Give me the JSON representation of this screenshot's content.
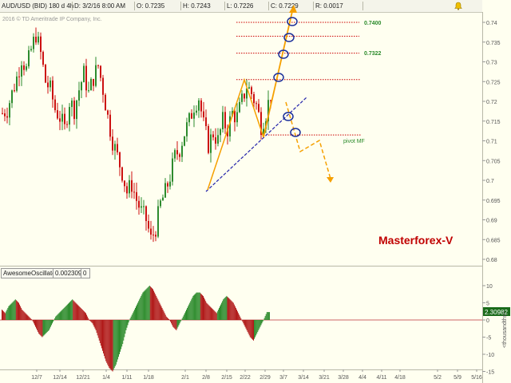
{
  "header": {
    "symbol": "AUD/USD (BID) 180 d 4h",
    "date": "D: 3/2/16 8:00 AM",
    "open": "O: 0.7235",
    "high": "H: 0.7243",
    "low": "L: 0.7226",
    "close": "C: 0.7229",
    "range": "R: 0.0017"
  },
  "copyright": "2016 © TD Ameritrade IP Company, Inc.",
  "oscillator": {
    "name": "AwesomeOscillator",
    "value": "0.0023098",
    "extra": "0",
    "last_value_tag": "2.30982",
    "units_label": "<thousandths>"
  },
  "annotations": {
    "brand": "Masterforex-V",
    "pivot": "pivot MF",
    "target_high": "0.7400",
    "target_mid": "0.7322"
  },
  "colors": {
    "up": "#2e8b2e",
    "down": "#cc1111",
    "osc_green": "#2b8a2b",
    "osc_red": "#b01818",
    "level_lines": "#cc0000",
    "orange": "#f5a000",
    "trend": "#2222aa",
    "circle": "#1a2f9a",
    "brand": "#c00000",
    "label_green": "#2a8a2a"
  },
  "chart_data": [
    {
      "type": "candlestick",
      "title": "AUD/USD (BID) 180 d 4h",
      "ylim": [
        0.678,
        0.745
      ],
      "y_ticks": [
        0.68,
        0.685,
        0.69,
        0.695,
        0.7,
        0.705,
        0.71,
        0.715,
        0.72,
        0.725,
        0.73,
        0.735,
        0.74
      ],
      "x_tick_labels": [
        "12/7",
        "12/14",
        "12/21",
        "1/4",
        "1/11",
        "1/18",
        "2/1",
        "2/8",
        "2/15",
        "2/22",
        "2/29",
        "3/7",
        "3/14",
        "3/21",
        "3/28",
        "4/4",
        "4/11",
        "4/18",
        "5/2",
        "5/9",
        "5/16"
      ],
      "close_path": [
        [
          0,
          0.717
        ],
        [
          6,
          0.718
        ],
        [
          12,
          0.722
        ],
        [
          18,
          0.726
        ],
        [
          24,
          0.731
        ],
        [
          30,
          0.728
        ],
        [
          36,
          0.733
        ],
        [
          42,
          0.737
        ],
        [
          48,
          0.732
        ],
        [
          54,
          0.725
        ],
        [
          60,
          0.723
        ],
        [
          66,
          0.718
        ],
        [
          72,
          0.716
        ],
        [
          78,
          0.713
        ],
        [
          84,
          0.72
        ],
        [
          90,
          0.718
        ],
        [
          96,
          0.723
        ],
        [
          102,
          0.727
        ],
        [
          108,
          0.722
        ],
        [
          114,
          0.726
        ],
        [
          120,
          0.729
        ],
        [
          126,
          0.723
        ],
        [
          132,
          0.716
        ],
        [
          138,
          0.71
        ],
        [
          144,
          0.706
        ],
        [
          150,
          0.702
        ],
        [
          156,
          0.697
        ],
        [
          162,
          0.699
        ],
        [
          168,
          0.695
        ],
        [
          174,
          0.692
        ],
        [
          180,
          0.69
        ],
        [
          186,
          0.685
        ],
        [
          192,
          0.688
        ],
        [
          198,
          0.694
        ],
        [
          204,
          0.697
        ],
        [
          210,
          0.701
        ],
        [
          216,
          0.706
        ],
        [
          222,
          0.708
        ],
        [
          228,
          0.712
        ],
        [
          234,
          0.715
        ],
        [
          240,
          0.719
        ],
        [
          246,
          0.721
        ],
        [
          252,
          0.714
        ],
        [
          258,
          0.709
        ],
        [
          264,
          0.712
        ],
        [
          270,
          0.71
        ],
        [
          276,
          0.715
        ],
        [
          282,
          0.713
        ],
        [
          288,
          0.717
        ],
        [
          294,
          0.716
        ],
        [
          300,
          0.72
        ],
        [
          306,
          0.724
        ],
        [
          312,
          0.722
        ],
        [
          318,
          0.719
        ],
        [
          324,
          0.714
        ],
        [
          330,
          0.717
        ],
        [
          336,
          0.722
        ],
        [
          338,
          0.723
        ]
      ],
      "levels": [
        0.74,
        0.7365,
        0.7322,
        0.7255,
        0.7115
      ],
      "level_labels": {
        "0.7400": "0.7400",
        "0.7322": "0.7322",
        "0.7115": "pivot MF"
      },
      "last_price": 0.7229
    },
    {
      "type": "bar",
      "title": "AwesomeOscillator",
      "ylim": [
        -15,
        12
      ],
      "y_ticks": [
        10,
        5,
        0,
        -5,
        -10,
        -15
      ],
      "unit": "thousandths",
      "values": [
        3,
        2,
        4,
        5,
        6,
        5,
        3,
        2,
        1,
        0,
        -2,
        -4,
        -5,
        -4,
        -3,
        -1,
        1,
        2,
        3,
        4,
        5,
        6,
        5,
        4,
        3,
        2,
        0,
        -1,
        -3,
        -6,
        -9,
        -12,
        -14,
        -15,
        -13,
        -10,
        -7,
        -3,
        0,
        2,
        4,
        6,
        8,
        9,
        10,
        9,
        7,
        5,
        3,
        1,
        0,
        -2,
        -3,
        -1,
        1,
        3,
        5,
        7,
        8,
        8,
        7,
        5,
        4,
        3,
        2,
        4,
        6,
        7,
        6,
        5,
        3,
        1,
        -1,
        -3,
        -5,
        -6,
        -4,
        -2,
        0,
        2.3
      ]
    }
  ]
}
